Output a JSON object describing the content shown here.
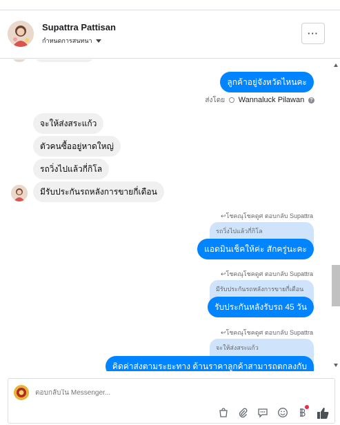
{
  "header": {
    "contact_name": "Supattra Pattisan",
    "status_label": "กำหนดการสนทนา",
    "more_label": "···"
  },
  "messages": {
    "out_province": "ลูกค้าอยู่จังหวัดไหนคะ",
    "sent_by_label": "ส่งโดย",
    "sent_by_name": "Wannaluck Pilawan",
    "in_1": "จะให้ส่งสระแก้ว",
    "in_2": "ตัวคนซื้ออยู่หาดใหญ่",
    "in_3": "รถวิ่งไปแล้วกี่กิโล",
    "in_4": "มีรับประกันรถหลังการขายกี่เดือน",
    "reply_1_note": "↩โชคณุโชคดูศ ตอบกลับ Supattra",
    "reply_1_quote": "รถวิ่งไปแล้วกี่กิโล",
    "reply_1_text": "แอดมินเช็คให้ค่ะ  สักครู่นะคะ",
    "reply_2_note": "↩โชคณุโชคดูศ ตอบกลับ Supattra",
    "reply_2_quote": "มีรับประกันรถหลังการขายกี่เดือน",
    "reply_2_text": "รับประกันหลังรับรถ 45 วัน",
    "reply_3_note": "↩โชคณุโชคดูศ ตอบกลับ Supattra",
    "reply_3_quote": "จะให้ส่งสระแก้ว",
    "reply_3_text": "คิดค่าส่งตามระยะทาง  ด้านราคาลูกค้าสามารถตกลงกับ"
  },
  "composer": {
    "placeholder": "ตอบกลับใน Messenger...",
    "tools": [
      "shopping-bag-icon",
      "paperclip-icon",
      "chat-bubble-icon",
      "emoji-icon",
      "bitcoin-icon",
      "thumbs-up-icon"
    ]
  },
  "colors": {
    "outgoing_bubble": "#0084ff",
    "incoming_bubble": "#f0f0f0",
    "quote_bubble": "#cfe4fb",
    "notification_dot": "#f02849"
  }
}
